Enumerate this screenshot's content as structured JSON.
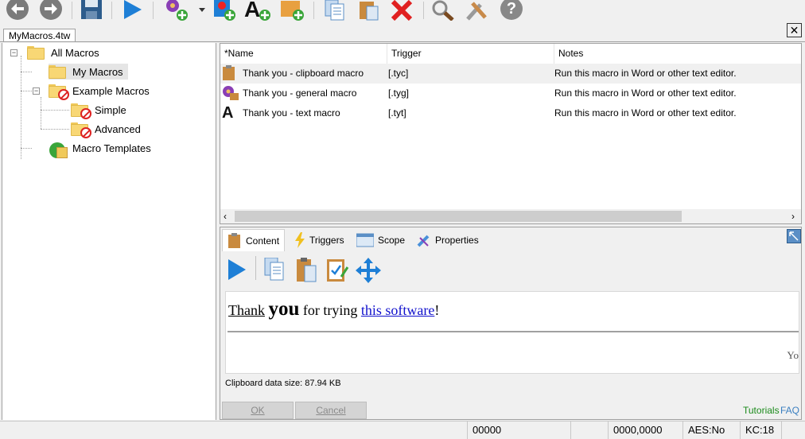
{
  "toolbar": {
    "buttons": [
      "back-icon",
      "forward-icon",
      "save-icon",
      "run-icon",
      "new-general-macro-icon",
      "new-clipboard-macro-icon",
      "new-text-macro-icon",
      "new-folder-icon",
      "copy-icon",
      "paste-icon",
      "delete-icon",
      "find-icon",
      "options-icon",
      "help-icon"
    ]
  },
  "document_tab": "MyMacros.4tw",
  "close_label": "✕",
  "tree": {
    "items": [
      {
        "label": "All Macros"
      },
      {
        "label": "My Macros"
      },
      {
        "label": "Example Macros"
      },
      {
        "label": "Simple"
      },
      {
        "label": "Advanced"
      },
      {
        "label": "Macro Templates"
      }
    ]
  },
  "list": {
    "columns": [
      "*Name",
      "Trigger",
      "Notes"
    ],
    "rows": [
      {
        "name": "Thank you - clipboard macro",
        "trigger": "[.tyc]",
        "notes": "Run this macro in Word or other text editor.",
        "icon": "clipboard-icon"
      },
      {
        "name": "Thank you - general macro",
        "trigger": "[.tyg]",
        "notes": "Run this macro in Word or other text editor.",
        "icon": "gear-icon"
      },
      {
        "name": "Thank you - text macro",
        "trigger": "[.tyt]",
        "notes": "Run this macro in Word or other text editor.",
        "icon": "text-a-icon"
      }
    ]
  },
  "tabs": [
    "Content",
    "Triggers",
    "Scope",
    "Properties"
  ],
  "content": {
    "word1": "Thank",
    "word2": "you",
    "word3": " for trying ",
    "link": "this software",
    "end": "!",
    "cutoff": "Yo",
    "size_label": "Clipboard data size: 87.94 KB"
  },
  "buttons": {
    "ok": "OK",
    "cancel": "Cancel"
  },
  "links": {
    "tutorials": "Tutorials",
    "faq": "FAQ"
  },
  "status": {
    "seg1": "00000",
    "seg2": "0000,0000",
    "aes": "AES:No",
    "kc": "KC:18"
  }
}
